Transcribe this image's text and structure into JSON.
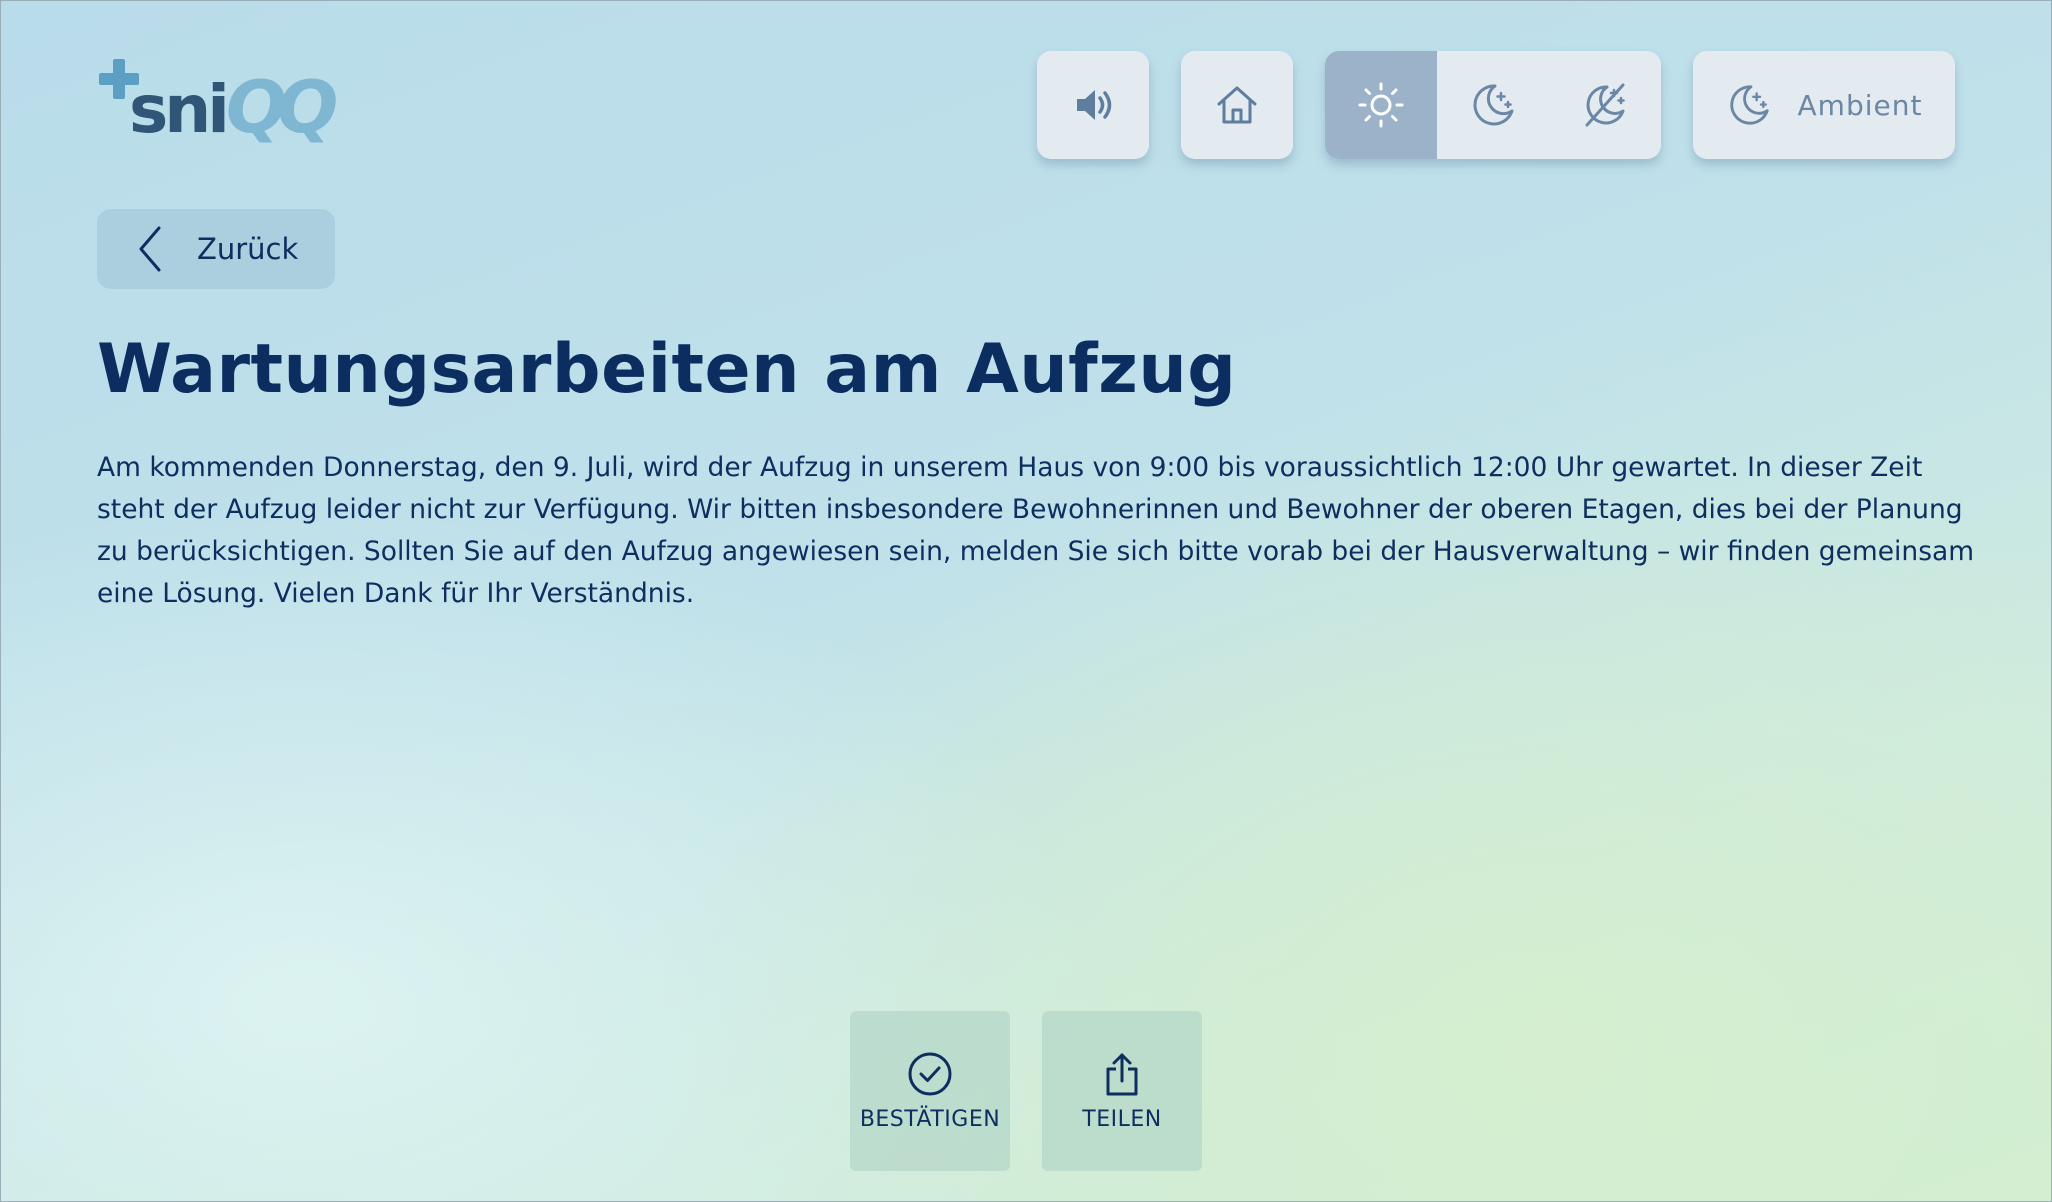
{
  "logo": {
    "plus": "+",
    "text": "sni",
    "qq": "QQ"
  },
  "topbar": {
    "sound_icon": "speaker-icon",
    "home_icon": "home-icon",
    "modes": [
      {
        "icon": "sun-icon",
        "active": true
      },
      {
        "icon": "moon-icon",
        "active": false
      },
      {
        "icon": "night-off-icon",
        "active": false
      }
    ],
    "ambient_label": "Ambient",
    "ambient_icon": "moon-icon"
  },
  "nav": {
    "back_label": "Zurück",
    "back_icon": "chevron-left-icon"
  },
  "article": {
    "title": "Wartungsarbeiten am Aufzug",
    "body": "Am kommenden Donnerstag, den 9. Juli, wird der Aufzug in unserem Haus von 9:00 bis voraussichtlich 12:00 Uhr gewartet. In dieser Zeit steht der Aufzug leider nicht zur Verfügung. Wir bitten insbesondere Bewohnerinnen und Bewohner der oberen Etagen, dies bei der Planung zu berücksichtigen. Sollten Sie auf den Aufzug angewiesen sein, melden Sie sich bitte vorab bei der Hausverwaltung – wir finden gemeinsam eine Lösung. Vielen Dank für Ihr Verständnis."
  },
  "actions": {
    "confirm_label": "BESTÄTIGEN",
    "share_label": "TEILEN"
  },
  "colors": {
    "primary_text": "#0b2d60",
    "button_bg": "#e3ebf0",
    "active_segment": "#9cb2c9",
    "icon": "#6b87a5"
  }
}
